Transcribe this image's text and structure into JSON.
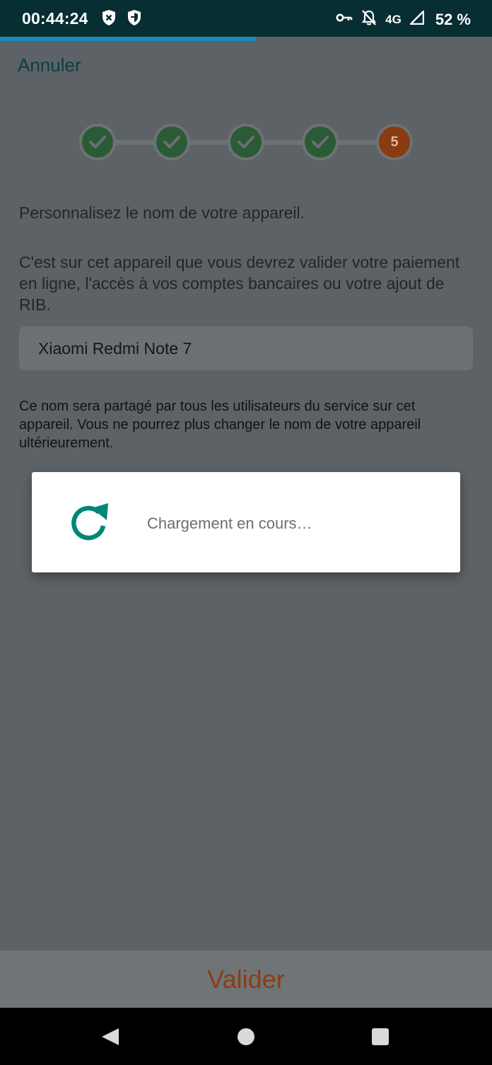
{
  "status_bar": {
    "time": "00:44:24",
    "network": "4G",
    "battery": "52 %",
    "icons": [
      "blocked-notification-shield-icon",
      "shield-icon",
      "vpn-key-icon",
      "notifications-off-icon",
      "signal-icon"
    ]
  },
  "progress": {
    "value_percent": 52
  },
  "header": {
    "cancel_label": "Annuler"
  },
  "stepper": {
    "steps": [
      {
        "state": "done"
      },
      {
        "state": "done"
      },
      {
        "state": "done"
      },
      {
        "state": "done"
      },
      {
        "state": "current",
        "label": "5"
      }
    ]
  },
  "content": {
    "title": "Personnalisez le nom de votre appareil.",
    "description": "C'est sur cet appareil que vous devrez valider votre paiement en ligne, l'accès à vos comptes bancaires ou votre ajout de RIB.",
    "device_name_value": "Xiaomi Redmi Note 7",
    "note": "Ce nom sera partagé par tous les utilisateurs du service sur cet appareil. Vous ne pourrez plus changer le nom de votre appareil ultérieurement."
  },
  "dialog": {
    "message": "Chargement en cours…",
    "icon": "refresh-icon"
  },
  "footer": {
    "validate_label": "Valider"
  },
  "colors": {
    "status_bar_bg": "#062e33",
    "progress_fill": "#1a8cb8",
    "step_done": "#2b5a37",
    "step_current": "#8a3b12",
    "accent_teal": "#008577",
    "validate_text": "#8d3c14"
  }
}
